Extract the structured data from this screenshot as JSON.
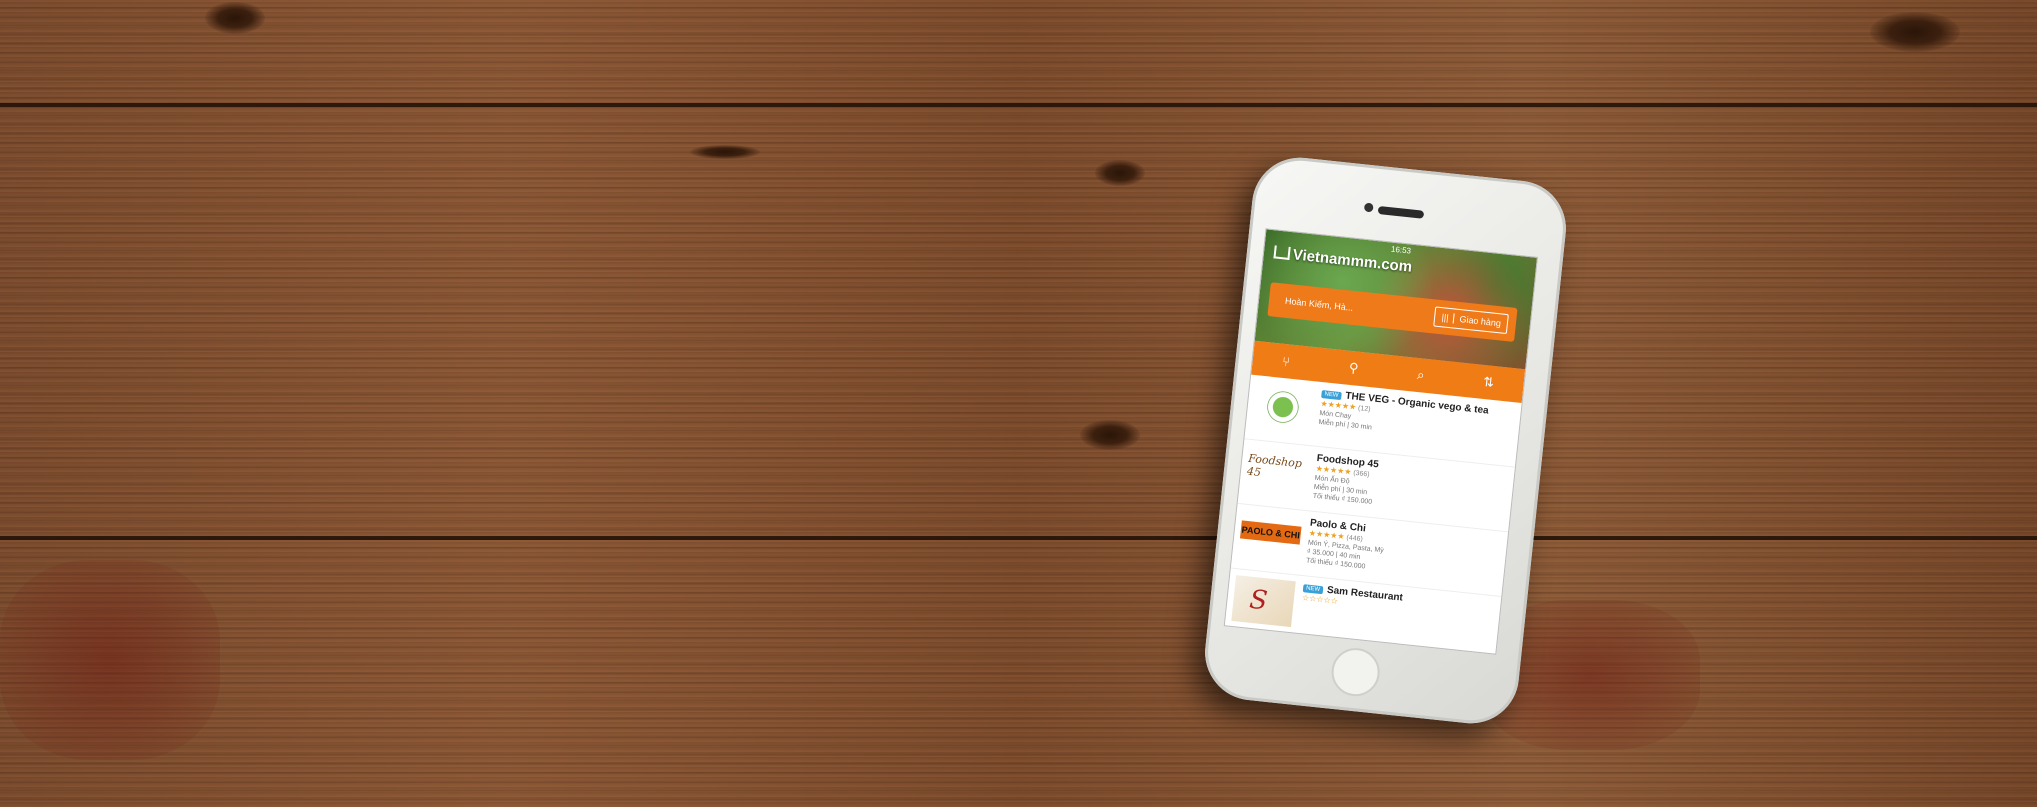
{
  "app": {
    "status_time": "16:53",
    "logo": "Vietnammm.com",
    "search": {
      "location_value": "Hoàn Kiếm, Hà...",
      "delivery_label": "Giao hàng",
      "delivery_bars": "|||"
    },
    "toolbar": {
      "cuisine_icon": "fork-knife-icon",
      "location_icon": "map-pin-icon",
      "search_icon": "search-icon",
      "sort_icon": "sort-icon"
    },
    "restaurants": [
      {
        "badge": "NEW",
        "name": "THE VEG - Organic vego & tea",
        "stars": "★★★★★",
        "rating_count": "(12)",
        "cuisine": "Món Chay",
        "meta": "Miễn phí | 30 min",
        "min_order": ""
      },
      {
        "badge": "",
        "name": "Foodshop 45",
        "stars": "★★★★★",
        "rating_count": "(366)",
        "cuisine": "Món Ấn Độ",
        "meta": "Miễn phí | 30 min",
        "min_order": "Tối thiểu ₫ 150.000"
      },
      {
        "badge": "",
        "name": "Paolo & Chi",
        "stars": "★★★★★",
        "rating_count": "(446)",
        "cuisine": "Món Ý, Pizza, Pasta, Mỳ",
        "meta": "₫ 35.000 | 40 min",
        "min_order": "Tối thiểu ₫ 150.000"
      },
      {
        "badge": "NEW",
        "name": "Sam Restaurant",
        "stars": "☆☆☆☆☆",
        "rating_count": "",
        "cuisine": "",
        "meta": "",
        "min_order": ""
      }
    ],
    "thumbs": {
      "foodshop_text": "Foodshop 45",
      "paolo_text": "PAOLO & CHI",
      "sam_letter": "S"
    },
    "colors": {
      "accent": "#f07c15",
      "badge": "#3aa0d8",
      "stars": "#f0a020"
    }
  }
}
